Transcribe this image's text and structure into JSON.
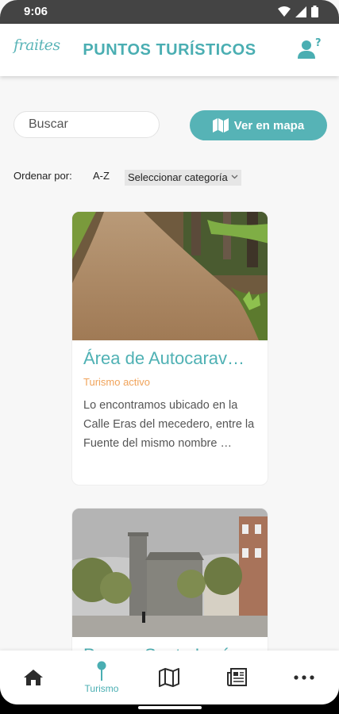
{
  "status_bar": {
    "time": "9:06"
  },
  "header": {
    "logo": "fraites",
    "title": "PUNTOS TURÍSTICOS"
  },
  "search": {
    "placeholder": "Buscar",
    "map_button": "Ver en mapa"
  },
  "sort": {
    "label": "Ordenar por:",
    "az": "A-Z",
    "category_select": "Seleccionar categoría"
  },
  "cards": [
    {
      "title": "Área de Autocarav…",
      "category": "Turismo activo",
      "description": "Lo encontramos ubicado en la Calle Eras del mecedero, entre la Fuente del mismo nombre …"
    },
    {
      "title": "Parque Santa Lucía"
    }
  ],
  "bottom_nav": [
    {
      "icon": "home-icon",
      "label": ""
    },
    {
      "icon": "pin-icon",
      "label": "Turismo"
    },
    {
      "icon": "map-icon",
      "label": ""
    },
    {
      "icon": "news-icon",
      "label": ""
    },
    {
      "icon": "more-icon",
      "label": ""
    }
  ],
  "colors": {
    "accent": "#4aaeb2",
    "category": "#f0a35a",
    "status_bar": "#444444"
  }
}
